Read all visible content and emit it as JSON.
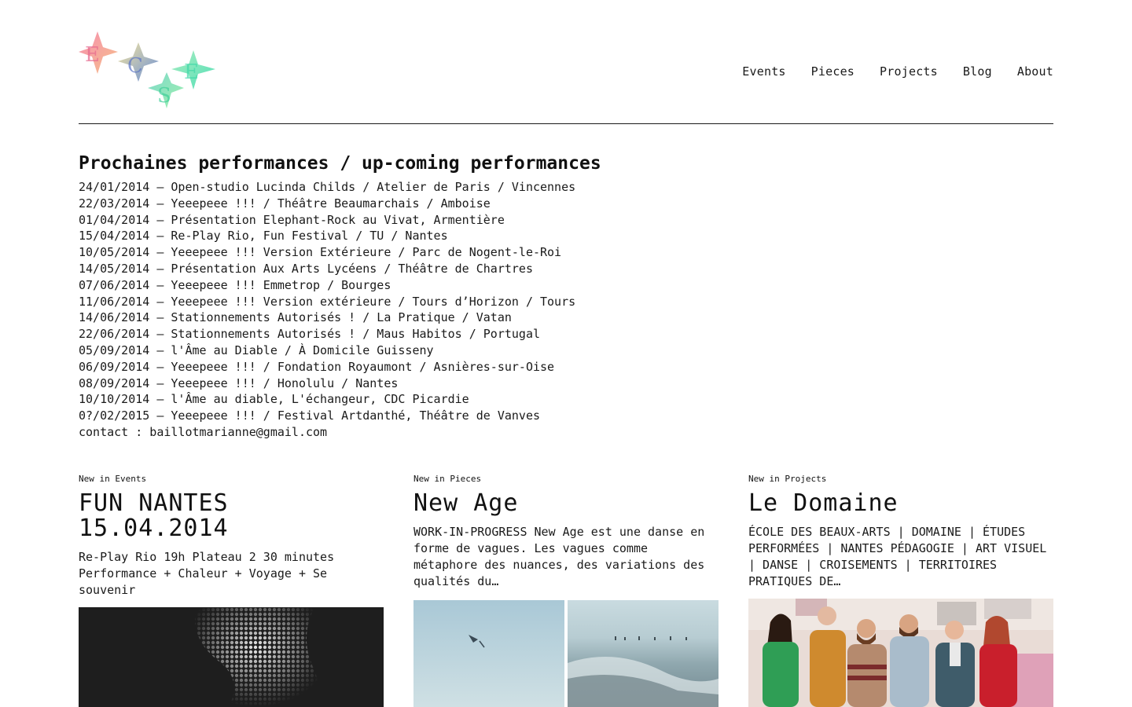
{
  "header": {
    "logo_text": "ECSE",
    "nav": [
      "Events",
      "Pieces",
      "Projects",
      "Blog",
      "About"
    ]
  },
  "upcoming": {
    "title": "Prochaines performances / up-coming performances",
    "lines": [
      "24/01/2014 – Open-studio Lucinda Childs / Atelier de Paris / Vincennes",
      "22/03/2014 – Yeeepeee !!! / Théâtre Beaumarchais / Amboise",
      "01/04/2014 – Présentation Elephant-Rock au Vivat, Armentière",
      "15/04/2014 – Re-Play Rio, Fun Festival / TU / Nantes",
      "10/05/2014 – Yeeepeee !!! Version Extérieure / Parc de Nogent-le-Roi",
      "14/05/2014 – Présentation Aux Arts Lycéens / Théâtre de Chartres",
      "07/06/2014 – Yeeepeee !!! Emmetrop / Bourges",
      "11/06/2014 – Yeeepeee !!! Version extérieure / Tours d’Horizon / Tours",
      "14/06/2014 – Stationnements Autorisés ! / La Pratique / Vatan",
      "22/06/2014 – Stationnements Autorisés ! / Maus Habitos / Portugal",
      "05/09/2014 – l'Âme au Diable / À Domicile Guisseny",
      "06/09/2014 – Yeeepeee !!! / Fondation Royaumont / Asnières-sur-Oise",
      "08/09/2014 – Yeeepeee !!! / Honolulu / Nantes",
      "10/10/2014 – l'Âme au diable, L'échangeur, CDC Picardie",
      "0?/02/2015 – Yeeepeee !!! / Festival Artdanthé, Théâtre de Vanves",
      "contact : baillotmarianne@gmail.com"
    ]
  },
  "events": {
    "kicker": "New in Events",
    "title_line1": "FUN NANTES",
    "title_line2": "15.04.2014",
    "desc": "Re-Play Rio 19h Plateau 2 30 minutes Performance + Chaleur + Voyage + Se souvenir"
  },
  "pieces": {
    "kicker": "New in Pieces",
    "title": "New Age",
    "desc": "WORK-IN-PROGRESS New Age est une danse en forme de vagues. Les vagues comme métaphore des nuances, des variations des qualités du…"
  },
  "projects": {
    "kicker": "New in Projects",
    "title": "Le Domaine",
    "desc": "ÉCOLE DES BEAUX-ARTS | DOMAINE | ÉTUDES PERFORMÉES | NANTES PÉDAGOGIE | ART VISUEL | DANSE | CROISEMENTS | TERRITOIRES PRATIQUES DE…"
  },
  "colors": {
    "text": "#1a1a1a",
    "background": "#ffffff"
  }
}
